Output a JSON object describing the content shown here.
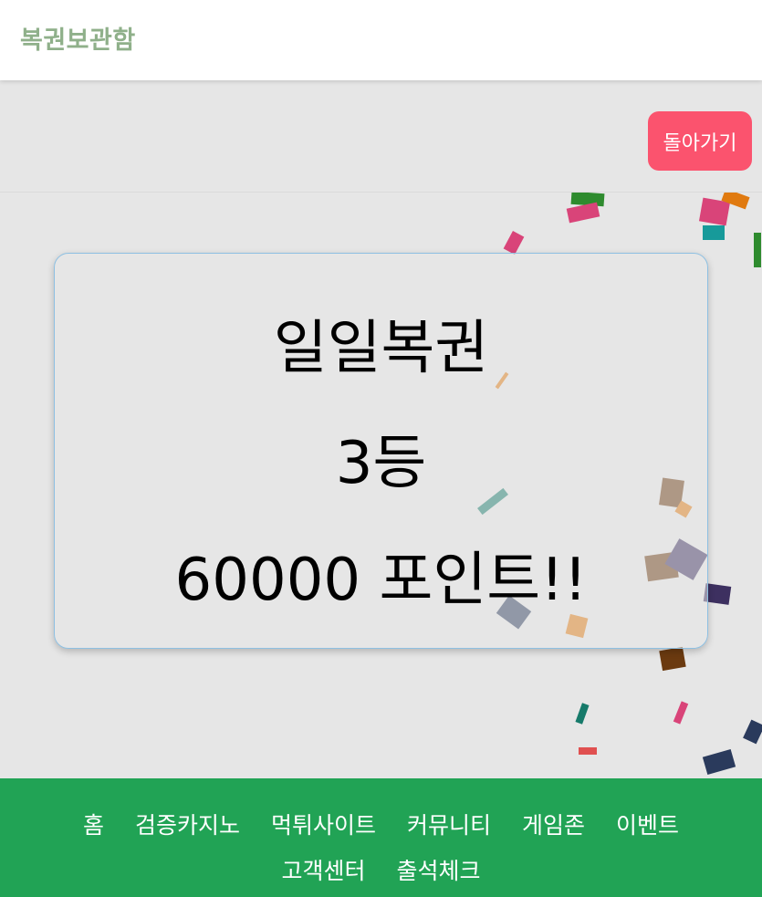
{
  "header": {
    "title": "복권보관함"
  },
  "back_button": {
    "label": "돌아가기"
  },
  "result": {
    "lottery_name": "일일복권",
    "rank": "3등",
    "prize": "60000 포인트!!"
  },
  "footer": {
    "nav_row1": [
      "홈",
      "검증카지노",
      "먹튀사이트",
      "커뮤니티",
      "게임존",
      "이벤트"
    ],
    "nav_row2": [
      "고객센터",
      "출석체크"
    ]
  },
  "colors": {
    "header_title": "#8fb08a",
    "back_button": "#fb536e",
    "footer": "#21a355",
    "card_border": "#8ec0e2",
    "confetti": [
      "#2e8b2e",
      "#d94479",
      "#179a9a",
      "#e07a10",
      "#6b3a10",
      "#3d3060",
      "#2a3a5c",
      "#e05050"
    ]
  }
}
